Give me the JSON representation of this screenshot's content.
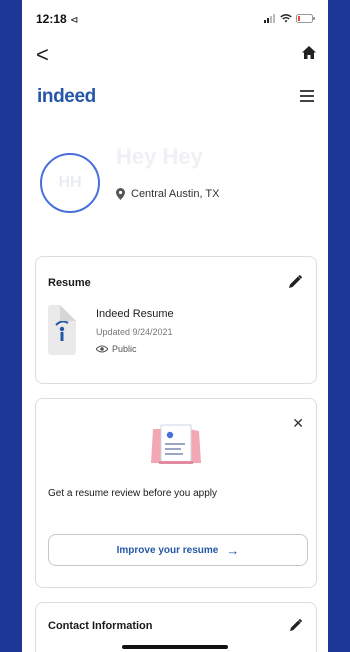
{
  "status_bar": {
    "time": "12:18",
    "location_glyph": "⊲"
  },
  "nav": {
    "back_glyph": "<"
  },
  "brand": {
    "logo": "indeed"
  },
  "profile": {
    "initials": "HH",
    "name": "Hey Hey",
    "location": "Central Austin, TX"
  },
  "resume": {
    "title": "Resume",
    "doc_name": "Indeed Resume",
    "updated": "Updated 9/24/2021",
    "visibility": "Public"
  },
  "review": {
    "close_glyph": "✕",
    "text": "Get a resume review before you apply",
    "button_label": "Improve your resume",
    "button_arrow": "→"
  },
  "contact": {
    "title": "Contact Information"
  },
  "colors": {
    "accent": "#2557a7",
    "frame": "#1c3796",
    "avatar_ring": "#4a6fdc"
  },
  "icons": [
    "signal-icon",
    "wifi-icon",
    "battery-icon",
    "back-icon",
    "home-icon",
    "menu-icon",
    "location-pin-icon",
    "edit-icon",
    "eye-icon",
    "close-icon",
    "arrow-right-icon"
  ]
}
